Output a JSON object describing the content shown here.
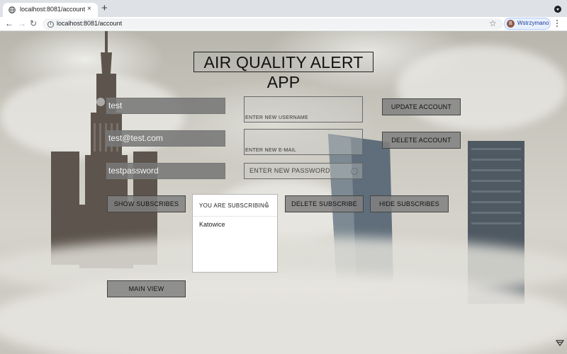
{
  "browser": {
    "tab_title": "localhost:8081/account",
    "tab_close": "×",
    "new_tab": "+",
    "url": "localhost:8081/account",
    "profile_initial": "B",
    "profile_name": "Wstrzymano"
  },
  "app": {
    "title": "AIR QUALITY ALERT APP",
    "current_username": "test",
    "current_email": "test@test.com",
    "current_password": "testpassword",
    "new_username_placeholder": "ENTER NEW USERNAME",
    "new_email_placeholder": "ENTER NEW E-MAIL",
    "new_password_placeholder": "ENTER NEW PASSWORD",
    "buttons": {
      "update_account": "UPDATE ACCOUNT",
      "delete_account": "DELETE ACCOUNT",
      "show_subscribes": "SHOW SUBSCRIBES",
      "delete_subscribe": "DELETE SUBSCRIBE",
      "hide_subscribes": "HIDE SUBSCRIBES",
      "main_view": "MAIN VIEW"
    },
    "subscriptions": {
      "header": "YOU ARE SUBSCRIBING",
      "items": [
        "Katowice"
      ]
    }
  },
  "colors": {
    "button_bg": "#808080",
    "field_bg": "#787878",
    "panel_bg": "#ffffff"
  }
}
